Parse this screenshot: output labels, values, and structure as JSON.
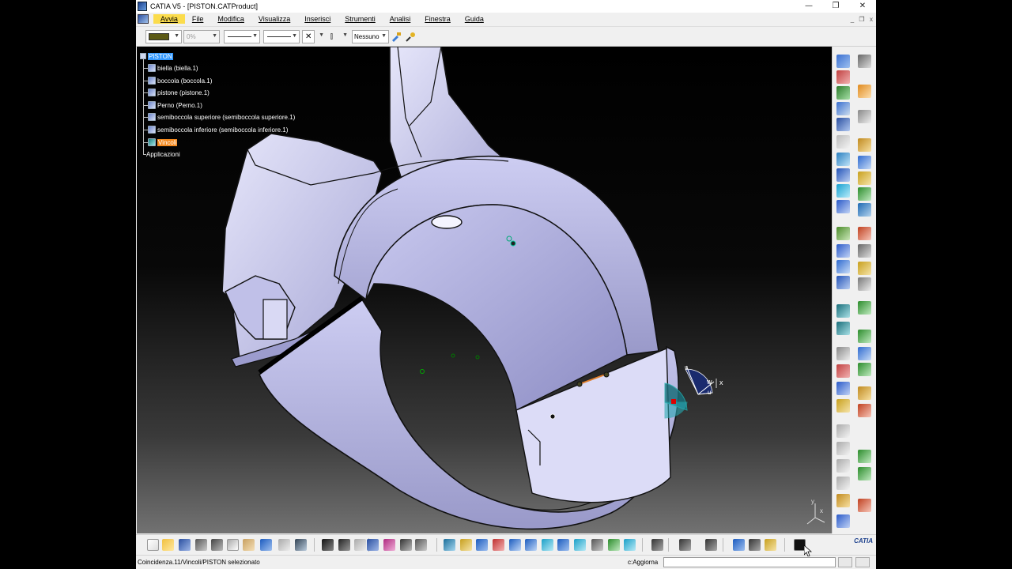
{
  "window": {
    "title": "CATIA V5 - [PISTON.CATProduct]",
    "min_glyph": "—",
    "max_glyph": "❐",
    "close_glyph": "✕"
  },
  "menu": {
    "items": [
      "Avvia",
      "File",
      "Modifica",
      "Visualizza",
      "Inserisci",
      "Strumenti",
      "Analisi",
      "Finestra",
      "Guida"
    ],
    "active": "Avvia",
    "mdi_min": "_",
    "mdi_restore": "❐",
    "mdi_close": "x"
  },
  "graphic_properties": {
    "color_swatch": "#5c5a16",
    "transparency": "0%",
    "layer": "Nessuno"
  },
  "spec_tree": {
    "root": "PISTON",
    "children": [
      "biella (biella.1)",
      "boccola (boccola.1)",
      "pistone (pistone.1)",
      "Perno (Perno.1)",
      "semiboccola superiore (semiboccola superiore.1)",
      "semiboccola inferiore (semiboccola inferiore.1)"
    ],
    "constraints": "Vincoli",
    "applications": "Applicazioni"
  },
  "compass": {
    "v": "v",
    "w": "w",
    "x": "x",
    "u": "u"
  },
  "axis": {
    "y": "y",
    "x": "x"
  },
  "statusbar": {
    "message": "Coincidenza.11/Vincoli/PISTON selezionato",
    "power_input_label": "c:Aggiorna",
    "power_input_value": ""
  },
  "brand": {
    "logo_text": "CATIA",
    "accent": "#1b3f8c",
    "selection": "#3399ff",
    "highlight": "#f58a1f",
    "part_color": "#c9c9ee"
  },
  "icons": {
    "window_icon": "catia-app-icon",
    "vertical_toolbar": [
      "assembly-constraints",
      "product-structure",
      "move-tools",
      "space-analysis",
      "sectioning",
      "view-tools"
    ],
    "bottom_toolbar": [
      "new",
      "open",
      "save",
      "print",
      "cut",
      "copy",
      "paste",
      "undo",
      "redo",
      "whats-this",
      "formula",
      "comment",
      "catalog",
      "tree-expand",
      "fly",
      "pan",
      "rotate",
      "zoom-in",
      "zoom-out",
      "normal-view",
      "iso-view",
      "hide-show",
      "swap",
      "render",
      "measure",
      "camera",
      "update",
      "mechanism",
      "black-swatch"
    ]
  }
}
